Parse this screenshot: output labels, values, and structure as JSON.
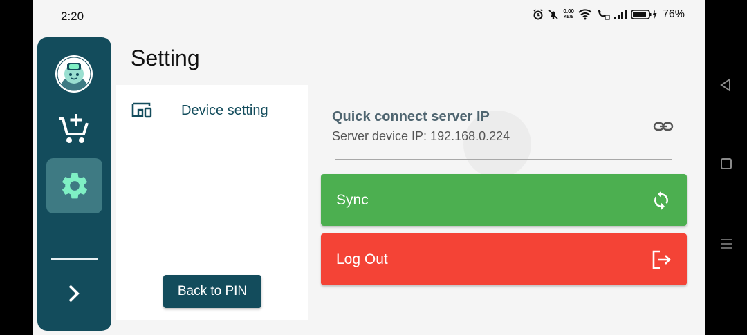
{
  "status_bar": {
    "time": "2:20",
    "net_speed_value": "0.00",
    "net_speed_unit": "KB/S",
    "battery_percent": "76%"
  },
  "rail": {
    "items": [
      {
        "name": "avatar",
        "icon": "robot-avatar-icon"
      },
      {
        "name": "add-to-cart",
        "icon": "add-cart-icon"
      },
      {
        "name": "settings",
        "icon": "gear-icon",
        "active": true
      },
      {
        "name": "expand",
        "icon": "chevron-right-icon"
      }
    ]
  },
  "page": {
    "title": "Setting"
  },
  "menu": {
    "items": [
      {
        "label": "Device setting",
        "icon": "devices-icon"
      }
    ],
    "back_button_label": "Back to PIN"
  },
  "quick_connect": {
    "title": "Quick connect server IP",
    "subtitle": "Server device IP: 192.168.0.224",
    "icon": "link-icon"
  },
  "actions": {
    "sync_label": "Sync",
    "logout_label": "Log Out"
  },
  "colors": {
    "primary": "#134c5c",
    "rail_active": "#3e7a83",
    "sync_green": "#4caf50",
    "logout_red": "#f44336",
    "icon_mint": "#7ff0c4"
  }
}
